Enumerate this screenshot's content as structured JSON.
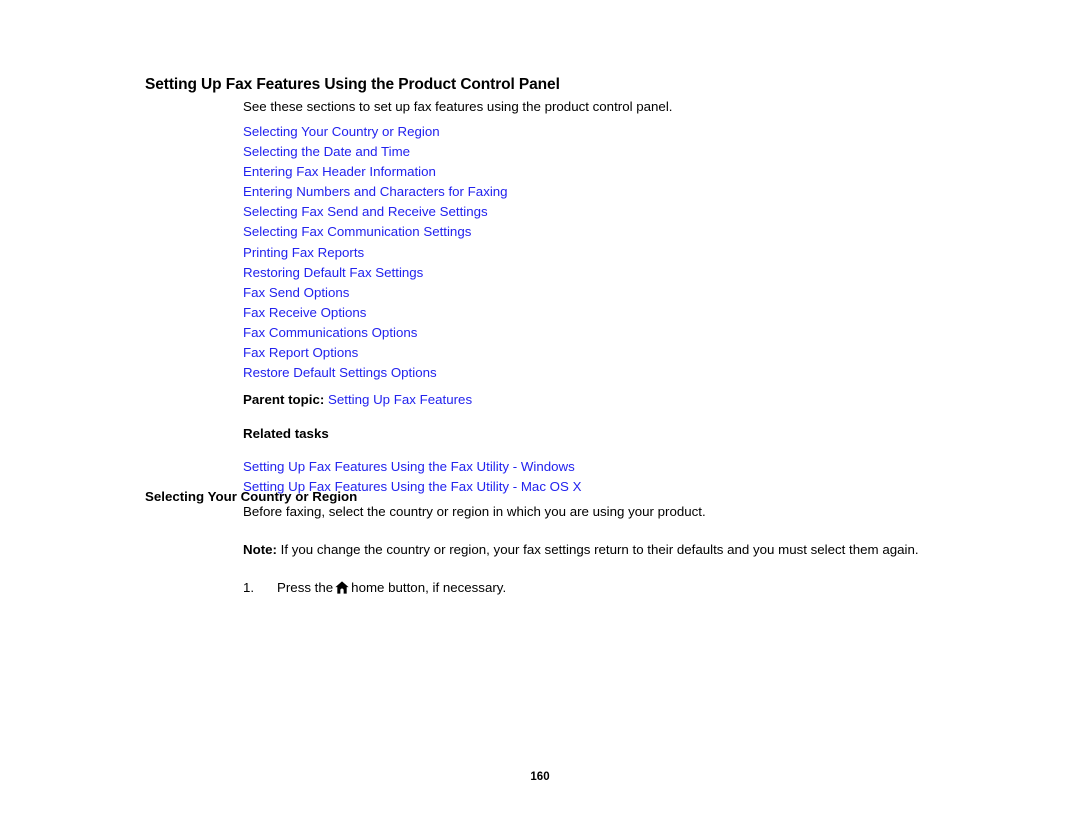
{
  "document": {
    "title": "Setting Up Fax Features Using the Product Control Panel",
    "intro": "See these sections to set up fax features using the product control panel.",
    "page_number": "160",
    "link_color": "#2222ee",
    "text_color": "#000000",
    "background_color": "#ffffff"
  },
  "section_links": [
    {
      "label": "Selecting Your Country or Region"
    },
    {
      "label": "Selecting the Date and Time"
    },
    {
      "label": "Entering Fax Header Information"
    },
    {
      "label": "Entering Numbers and Characters for Faxing"
    },
    {
      "label": "Selecting Fax Send and Receive Settings"
    },
    {
      "label": "Selecting Fax Communication Settings"
    },
    {
      "label": "Printing Fax Reports"
    },
    {
      "label": "Restoring Default Fax Settings"
    },
    {
      "label": "Fax Send Options"
    },
    {
      "label": "Fax Receive Options"
    },
    {
      "label": "Fax Communications Options"
    },
    {
      "label": "Fax Report Options"
    },
    {
      "label": "Restore Default Settings Options"
    }
  ],
  "parent_topic": {
    "label": "Parent topic:",
    "link": "Setting Up Fax Features"
  },
  "related_tasks": {
    "heading": "Related tasks",
    "links": [
      {
        "label": "Setting Up Fax Features Using the Fax Utility - Windows"
      },
      {
        "label": "Setting Up Fax Features Using the Fax Utility - Mac OS X"
      }
    ]
  },
  "section": {
    "heading": "Selecting Your Country or Region",
    "paragraph": "Before faxing, select the country or region in which you are using your product.",
    "note_label": "Note:",
    "note_text": " If you change the country or region, your fax settings return to their defaults and you must select them again.",
    "steps": [
      {
        "number": "1.",
        "text_before": "Press the",
        "icon": "home-icon",
        "text_after": "home button, if necessary."
      }
    ]
  }
}
